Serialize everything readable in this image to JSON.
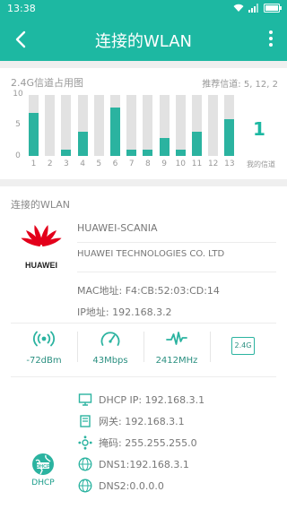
{
  "status_bar": {
    "time": "13:38"
  },
  "header": {
    "title": "连接的WLAN"
  },
  "channels": {
    "title": "2.4G信道占用图",
    "recommend": "推荐信道: 5, 12, 2",
    "y_ticks": [
      "10",
      "5",
      "0"
    ],
    "my_channel_value": "1",
    "my_channel_label": "我的信道",
    "color_fill": "#2bb3a0",
    "color_track": "#e2e2e2",
    "chart_data": {
      "type": "bar",
      "categories": [
        "1",
        "2",
        "3",
        "4",
        "5",
        "6",
        "7",
        "8",
        "9",
        "10",
        "11",
        "12",
        "13"
      ],
      "values": [
        7,
        0,
        1,
        4,
        0,
        8,
        1,
        1,
        3,
        1,
        4,
        0,
        6
      ],
      "ylim": [
        0,
        10
      ]
    }
  },
  "wlan": {
    "section_label": "连接的WLAN",
    "logo_text": "HUAWEI",
    "ssid": "HUAWEI-SCANIA",
    "vendor": "HUAWEI TECHNOLOGIES CO. LTD",
    "mac": "MAC地址:  F4:CB:52:03:CD:14",
    "ip": "IP地址:  192.168.3.2",
    "stats": {
      "signal": "-72dBm",
      "speed": "43Mbps",
      "frequency": "2412MHz",
      "band": "2.4G"
    },
    "dhcp_caption": "DHCP",
    "network": {
      "dhcp_ip": "DHCP IP:  192.168.3.1",
      "gateway": "网关:  192.168.3.1",
      "mask": "掩码:  255.255.255.0",
      "dns1": "DNS1:192.168.3.1",
      "dns2": "DNS2:0.0.0.0"
    }
  }
}
